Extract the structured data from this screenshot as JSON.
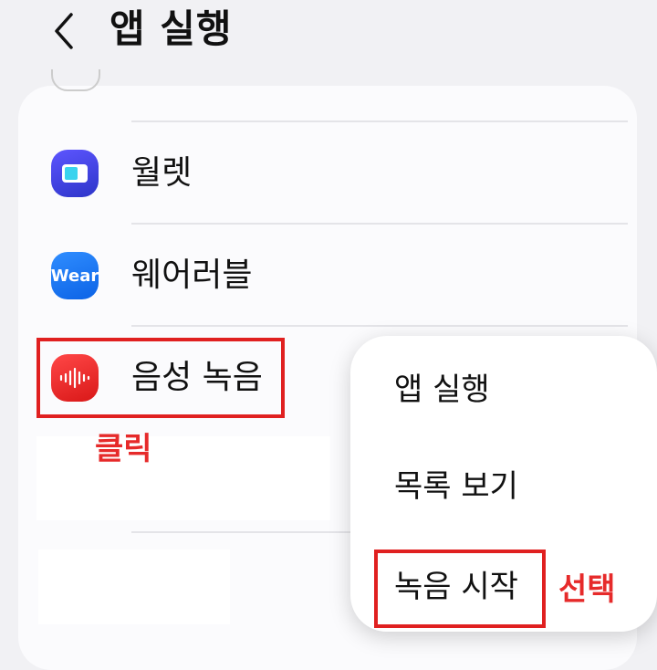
{
  "header": {
    "title": "앱 실행",
    "back_icon": "chevron-left-icon"
  },
  "list": {
    "items": [
      {
        "label": "월렛",
        "icon": "wallet-icon"
      },
      {
        "label": "웨어러블",
        "icon": "wear-icon",
        "icon_text": "Wear"
      },
      {
        "label": "음성 녹음",
        "icon": "voice-recorder-icon"
      }
    ]
  },
  "popup_menu": {
    "items": [
      {
        "label": "앱 실행"
      },
      {
        "label": "목록 보기"
      },
      {
        "label": "녹음 시작"
      }
    ]
  },
  "annotations": {
    "click": "클릭",
    "select": "선택"
  },
  "colors": {
    "highlight": "#e02020",
    "background": "#f1f1f4"
  }
}
